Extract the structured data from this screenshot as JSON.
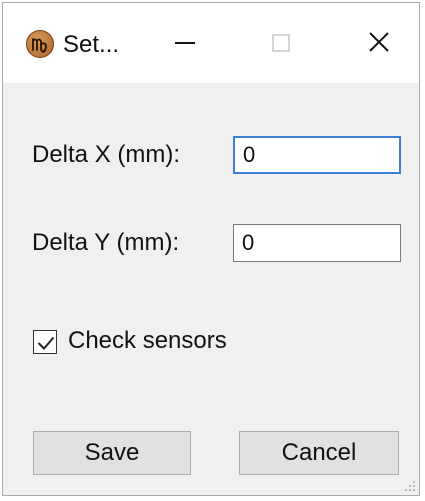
{
  "window": {
    "title": "Set...",
    "icon": "virgo-zodiac-icon",
    "controls": {
      "minimize": "minimize-icon",
      "maximize": "maximize-icon",
      "close": "close-icon"
    }
  },
  "form": {
    "delta_x": {
      "label": "Delta X (mm):",
      "value": "0"
    },
    "delta_y": {
      "label": "Delta Y (mm):",
      "value": "0"
    },
    "check_sensors": {
      "label": "Check sensors",
      "checked": true
    }
  },
  "buttons": {
    "save": "Save",
    "cancel": "Cancel"
  },
  "colors": {
    "focus_border": "#3c7fd3",
    "window_bg": "#f0f0f0",
    "titlebar_bg": "#ffffff",
    "button_bg": "#e1e1e1"
  }
}
